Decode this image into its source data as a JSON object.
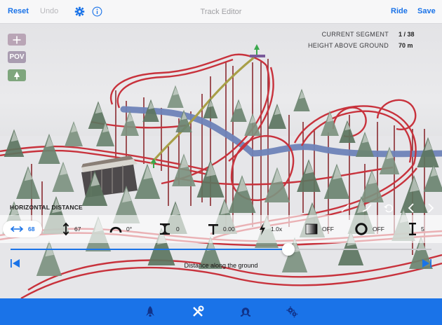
{
  "topbar": {
    "reset_label": "Reset",
    "undo_label": "Undo",
    "settings_icon": "gear-icon",
    "info_icon": "info-icon",
    "title": "Track Editor",
    "ride_label": "Ride",
    "save_label": "Save"
  },
  "side_buttons": {
    "add_icon": "plus-icon",
    "pov_label": "POV",
    "tree_icon": "tree-icon"
  },
  "readouts": {
    "segment_label": "CURRENT SEGMENT",
    "segment_value": "1 / 38",
    "height_label": "HEIGHT ABOVE GROUND",
    "height_value": "70 m"
  },
  "parameter": {
    "title": "HORIZONTAL DISTANCE",
    "caption": "Distance along the ground",
    "slider_fraction": 0.66
  },
  "tools": [
    {
      "icon": "horizontal-distance-icon",
      "value": "68",
      "active": true
    },
    {
      "icon": "vertical-height-icon",
      "value": "67"
    },
    {
      "icon": "curve-icon",
      "value": "0°"
    },
    {
      "icon": "twist-icon",
      "value": "0"
    },
    {
      "icon": "bank-icon",
      "value": "0.00"
    },
    {
      "icon": "boost-icon",
      "value": "1.0x"
    },
    {
      "icon": "tunnel-icon",
      "value": "OFF"
    },
    {
      "icon": "loop-icon",
      "value": "OFF"
    },
    {
      "icon": "support-icon",
      "value": "5"
    }
  ],
  "tabs": [
    "ride-icon",
    "tools-icon",
    "loop-track-icon",
    "settings-gears-icon"
  ],
  "colors": {
    "accent": "#1a73e8",
    "track_red": "#c8323c",
    "track_blue": "#7b8fc2",
    "track_yellow": "#b0a24a",
    "tree": "#5f7760",
    "side_button": "#a99cb0",
    "side_button_green": "#7fa67d"
  }
}
